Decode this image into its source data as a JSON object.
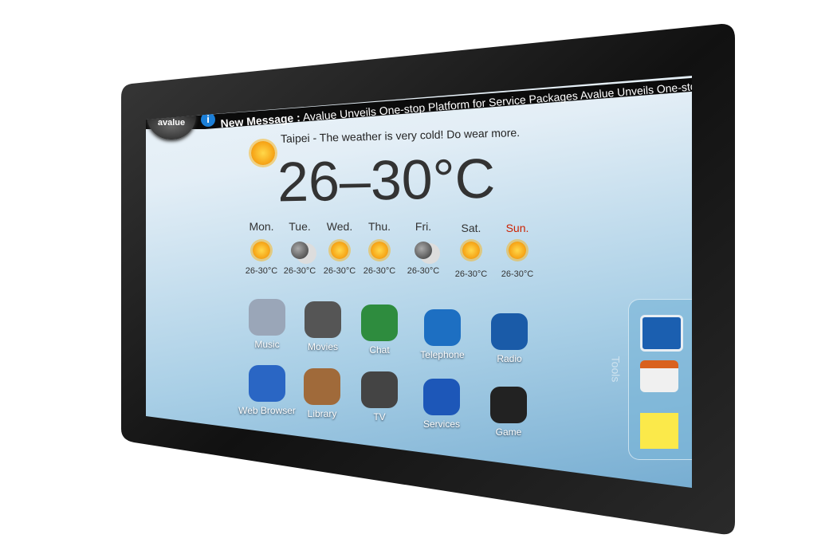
{
  "ticker": {
    "label": "New Message :",
    "message": "Avalue Unveils One-stop Platform for Service Packages  Avalue Unveils One-stop Platform"
  },
  "logo": "avalue",
  "weather": {
    "headline": "Taipei - The weather is very cold! Do wear more.",
    "temperature": "26–30",
    "unit": "°C",
    "icon": "sun-icon",
    "forecast": [
      {
        "day": "Mon.",
        "temp": "26-30°C",
        "icon": "sunny"
      },
      {
        "day": "Tue.",
        "temp": "26-30°C",
        "icon": "night-cloudy"
      },
      {
        "day": "Wed.",
        "temp": "26-30°C",
        "icon": "partly-cloudy"
      },
      {
        "day": "Thu.",
        "temp": "26-30°C",
        "icon": "sunny"
      },
      {
        "day": "Fri.",
        "temp": "26-30°C",
        "icon": "night-cloudy"
      },
      {
        "day": "Sat.",
        "temp": "26-30°C",
        "icon": "partly-cloudy"
      },
      {
        "day": "Sun.",
        "temp": "26-30°C",
        "icon": "sunny",
        "color": "#cc2200"
      }
    ]
  },
  "apps": [
    {
      "label": "Music",
      "icon": "music-cd-icon"
    },
    {
      "label": "Movies",
      "icon": "film-reel-icon"
    },
    {
      "label": "Chat",
      "icon": "chat-people-icon"
    },
    {
      "label": "Telephone",
      "icon": "telephone-icon"
    },
    {
      "label": "Radio",
      "icon": "globe-headphones-icon"
    },
    {
      "label": "Web Browser",
      "icon": "globe-browser-icon"
    },
    {
      "label": "Library",
      "icon": "books-icon"
    },
    {
      "label": "TV",
      "icon": "tv-icon"
    },
    {
      "label": "Services",
      "icon": "service-person-icon"
    },
    {
      "label": "Game",
      "icon": "gamepad-icon"
    }
  ],
  "tools": {
    "label": "Tools",
    "items": [
      "keyboard-icon",
      "calendar-icon",
      "sticky-note-icon"
    ]
  }
}
